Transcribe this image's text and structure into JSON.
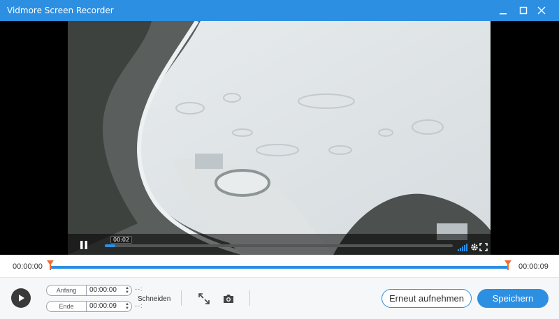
{
  "window": {
    "title": "Vidmore Screen Recorder",
    "accent": "#2c8fe2"
  },
  "player": {
    "current_time_tip": "00:02",
    "progress_fraction": 0.03,
    "icons": [
      "pause-icon",
      "volume-icon",
      "settings-icon",
      "fullscreen-icon"
    ]
  },
  "trim": {
    "start_time": "00:00:00",
    "end_time": "00:00:09"
  },
  "clip": {
    "start_label": "Anfang",
    "start_value": "00:00:00",
    "end_label": "Ende",
    "end_value": "00:00:09",
    "cut_label": "Schneiden"
  },
  "actions": {
    "rerecord_label": "Erneut aufnehmen",
    "save_label": "Speichern"
  }
}
